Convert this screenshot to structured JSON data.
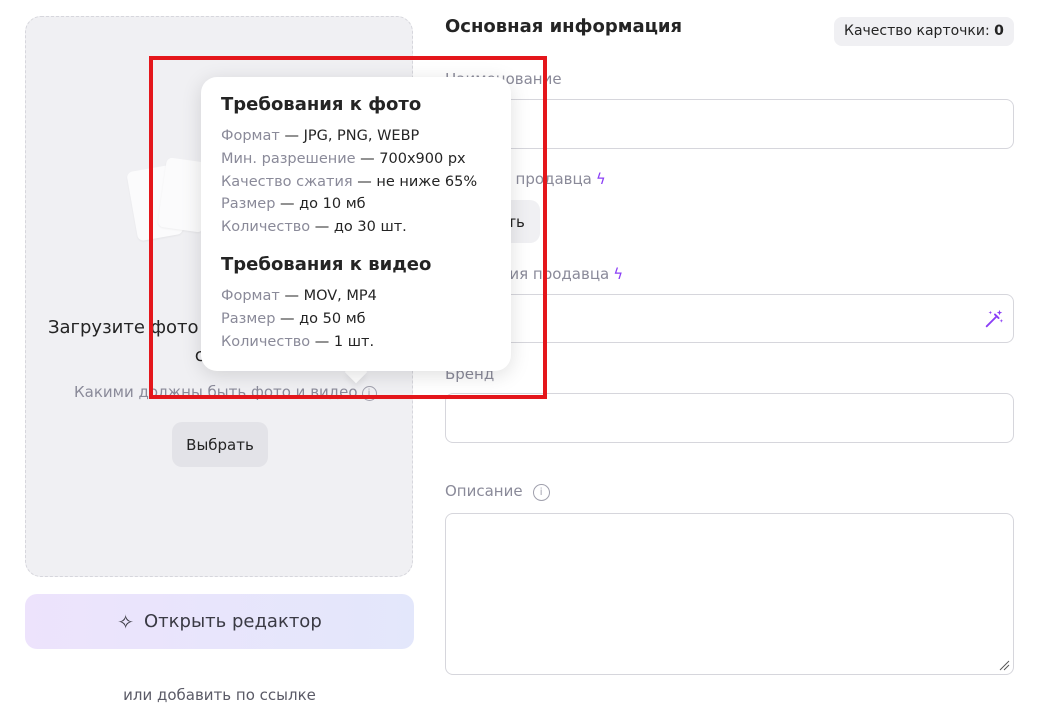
{
  "upload": {
    "title": "Загрузите фото или перетащите их сюда",
    "hint": "Какими должны быть фото и видео",
    "choose_label": "Выбрать",
    "editor_label": "Открыть редактор",
    "link_label": "или добавить по ссылке"
  },
  "form": {
    "section_title": "Основная информация",
    "quality_label": "Качество карточки:",
    "quality_value": "0",
    "name_label": "Наименование",
    "article_label": "Артикул продавца",
    "generate_label": "Создать",
    "category_label": "Категория продавца",
    "brand_label": "Бренд",
    "description_label": "Описание"
  },
  "tooltip": {
    "photo_title": "Требования к фото",
    "photo_lines": [
      {
        "k": "Формат",
        "v": "JPG, PNG, WEBP"
      },
      {
        "k": "Мин. разрешение",
        "v": "700x900 px"
      },
      {
        "k": "Качество сжатия",
        "v": "не ниже 65%"
      },
      {
        "k": "Размер",
        "v": "до 10 мб"
      },
      {
        "k": "Количество",
        "v": "до 30 шт."
      }
    ],
    "video_title": "Требования к видео",
    "video_lines": [
      {
        "k": "Формат",
        "v": "MOV, MP4"
      },
      {
        "k": "Размер",
        "v": "до 50 мб"
      },
      {
        "k": "Количество",
        "v": "1 шт."
      }
    ]
  },
  "colors": {
    "accent": "#8b3ff6",
    "highlight": "#e4161b",
    "panel_bg": "#f0f0f3"
  }
}
